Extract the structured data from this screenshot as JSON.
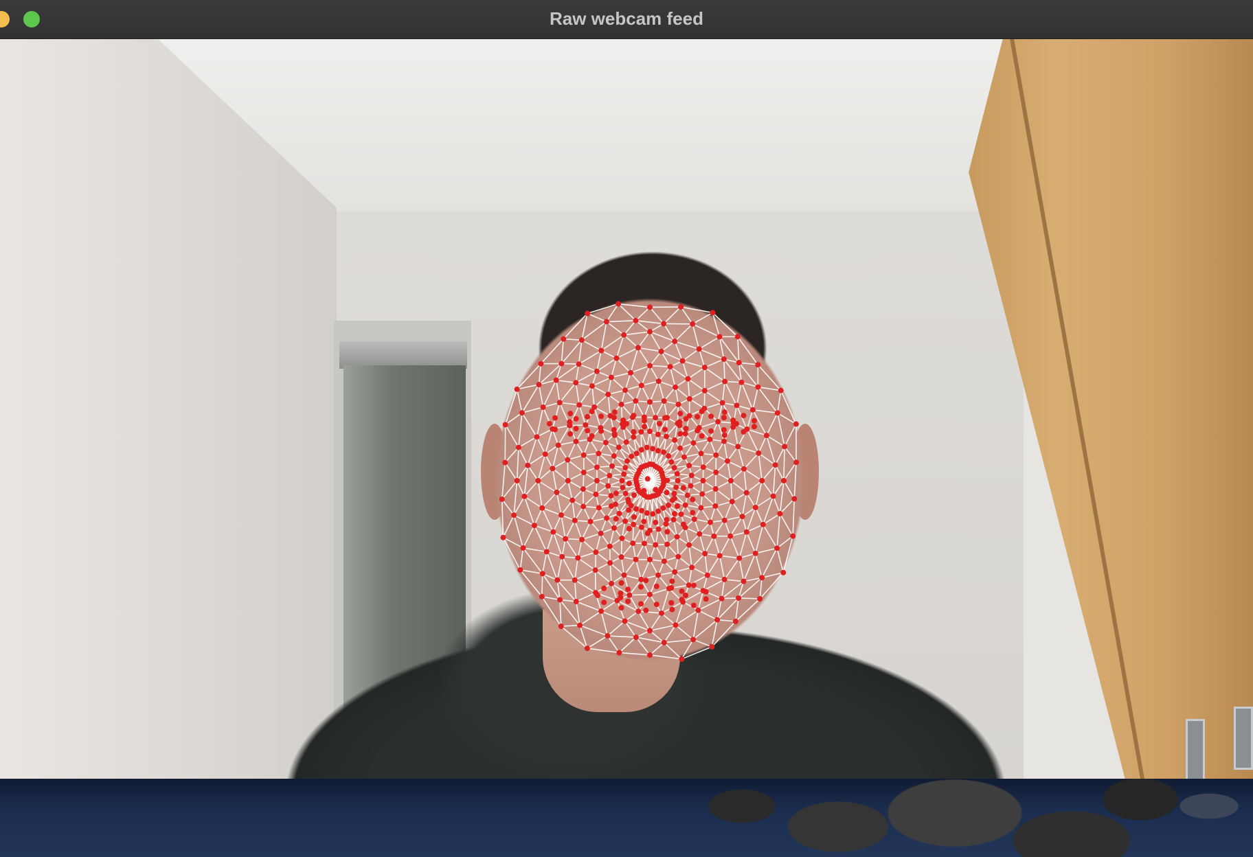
{
  "window": {
    "title": "Raw webcam feed"
  },
  "overlay": {
    "line_color": "#ffffff",
    "landmark_color": "#e02020"
  }
}
